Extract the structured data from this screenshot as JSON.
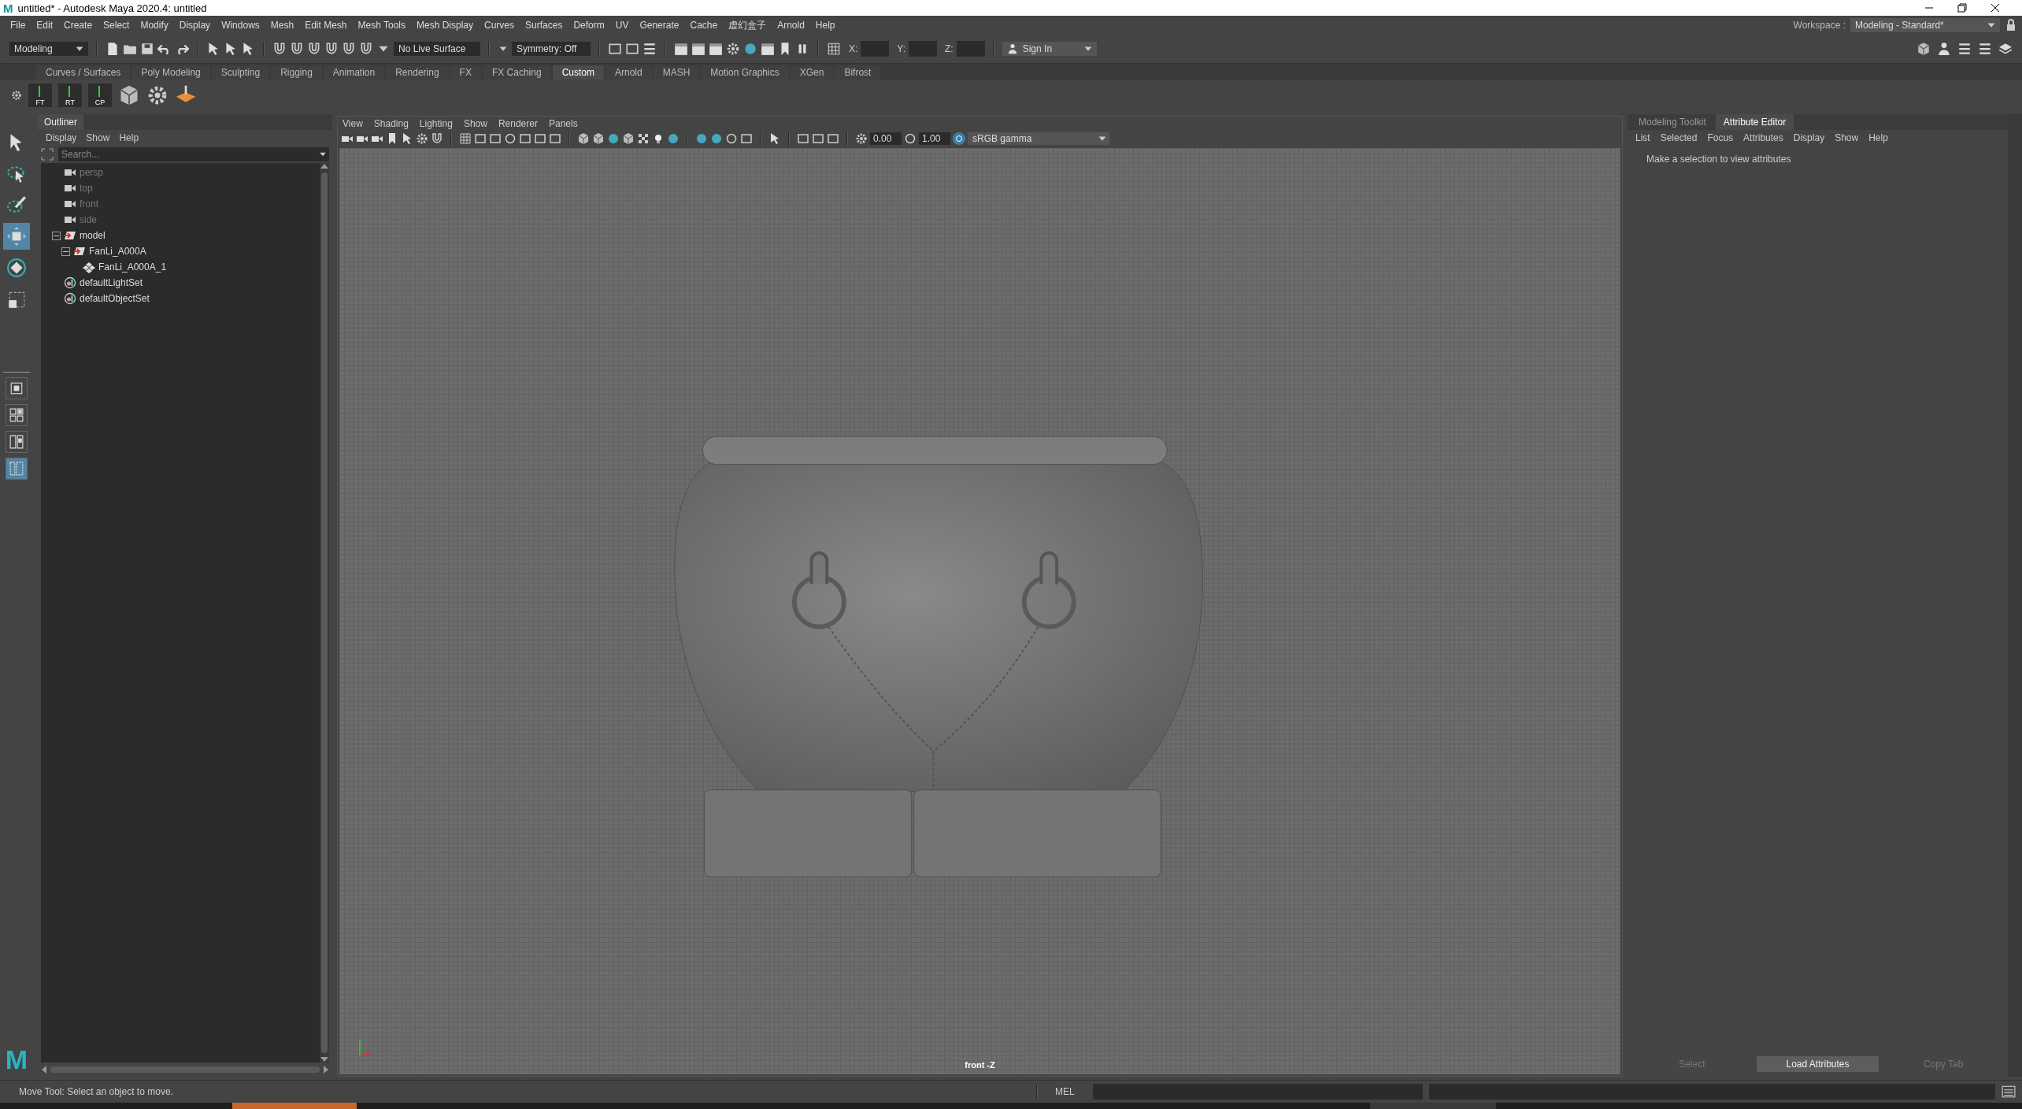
{
  "window": {
    "logo": "M",
    "title": "untitled* - Autodesk Maya 2020.4: untitled"
  },
  "menu_bar": {
    "items": [
      "File",
      "Edit",
      "Create",
      "Select",
      "Modify",
      "Display",
      "Windows",
      "Mesh",
      "Edit Mesh",
      "Mesh Tools",
      "Mesh Display",
      "Curves",
      "Surfaces",
      "Deform",
      "UV",
      "Generate",
      "Cache",
      "虚幻盒子",
      "Arnold",
      "Help"
    ],
    "workspace_label": "Workspace :",
    "workspace": "Modeling - Standard*"
  },
  "status_line": {
    "mode": "Modeling",
    "live_surface": "No Live Surface",
    "symmetry": "Symmetry: Off",
    "coords": [
      "X:",
      "Y:",
      "Z:"
    ],
    "sign_in": "Sign In"
  },
  "shelf": {
    "tabs": [
      {
        "label": "Curves / Surfaces",
        "selected": false
      },
      {
        "label": "Poly Modeling",
        "selected": false
      },
      {
        "label": "Sculpting",
        "selected": false
      },
      {
        "label": "Rigging",
        "selected": false
      },
      {
        "label": "Animation",
        "selected": false
      },
      {
        "label": "Rendering",
        "selected": false
      },
      {
        "label": "FX",
        "selected": false
      },
      {
        "label": "FX Caching",
        "selected": false
      },
      {
        "label": "Custom",
        "selected": true
      },
      {
        "label": "Arnold",
        "selected": false
      },
      {
        "label": "MASH",
        "selected": false
      },
      {
        "label": "Motion Graphics",
        "selected": false
      },
      {
        "label": "XGen",
        "selected": false
      },
      {
        "label": "Bifrost",
        "selected": false
      }
    ],
    "buttons": [
      "FT",
      "RT",
      "CP"
    ]
  },
  "tool_box": {
    "tools": [
      {
        "selected": false
      },
      {
        "selected": false
      },
      {
        "selected": false
      },
      {
        "selected": true
      },
      {
        "selected": false
      },
      {
        "selected": false
      }
    ],
    "layouts": [
      {
        "selected": false
      },
      {
        "selected": false
      },
      {
        "selected": false
      },
      {
        "selected": true
      }
    ],
    "logo": "M"
  },
  "outliner": {
    "title": "Outliner",
    "menus": [
      "Display",
      "Show",
      "Help"
    ],
    "search": {
      "placeholder": "Search..."
    },
    "items": [
      {
        "label": "persp",
        "kind": "camera",
        "dimmed": true
      },
      {
        "label": "top",
        "kind": "camera",
        "dimmed": true
      },
      {
        "label": "front",
        "kind": "camera",
        "dimmed": true
      },
      {
        "label": "side",
        "kind": "camera",
        "dimmed": true
      },
      {
        "label": "model",
        "kind": "group",
        "dimmed": false,
        "expanded": true,
        "children": [
          {
            "label": "FanLi_A000A",
            "kind": "group",
            "dimmed": false,
            "expanded": true,
            "children": [
              {
                "label": "FanLi_A000A_1",
                "kind": "mesh",
                "dimmed": false
              }
            ]
          }
        ]
      },
      {
        "label": "defaultLightSet",
        "kind": "set",
        "dimmed": false
      },
      {
        "label": "defaultObjectSet",
        "kind": "set",
        "dimmed": false
      }
    ]
  },
  "viewport": {
    "menus": [
      "View",
      "Shading",
      "Lighting",
      "Show",
      "Renderer",
      "Panels"
    ],
    "exposure": "0.00",
    "gamma": "1.00",
    "color_space": "sRGB gamma",
    "camera_label": "front -Z"
  },
  "attribute_editor": {
    "tabs": [
      {
        "label": "Modeling Toolkit",
        "selected": false
      },
      {
        "label": "Attribute Editor",
        "selected": true
      }
    ],
    "menus": [
      "List",
      "Selected",
      "Focus",
      "Attributes",
      "Display",
      "Show",
      "Help"
    ],
    "message": "Make a selection to view attributes",
    "buttons": [
      {
        "label": "Select",
        "disabled": true
      },
      {
        "label": "Load Attributes",
        "disabled": false
      },
      {
        "label": "Copy Tab",
        "disabled": true
      }
    ]
  },
  "command_line": {
    "help": "Move Tool: Select an object to move.",
    "language": "MEL"
  }
}
